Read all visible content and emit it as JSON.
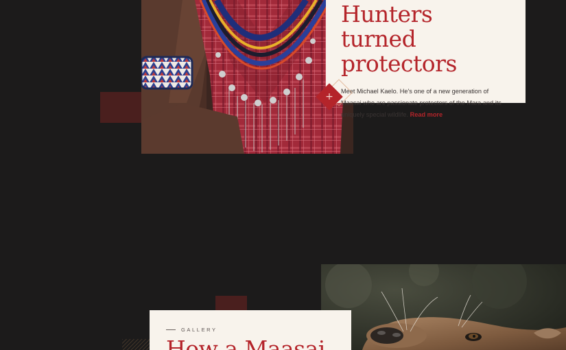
{
  "story": {
    "title": "Hunters turned protectors",
    "body": "Meet Michael Kaelo. He's one of a new generation of Maasai who are passionate protectors of the Mara and its uniquely special wildlife.",
    "read_more": "Read more",
    "plus_icon": "plus-icon",
    "expand_symbol": "+"
  },
  "gallery": {
    "eyebrow": "GALLERY",
    "title": "How a Maasai"
  },
  "colors": {
    "background": "#1c1b1b",
    "accent": "#b4242a",
    "card": "#f8f3ec",
    "deco": "#4a1f1e"
  }
}
